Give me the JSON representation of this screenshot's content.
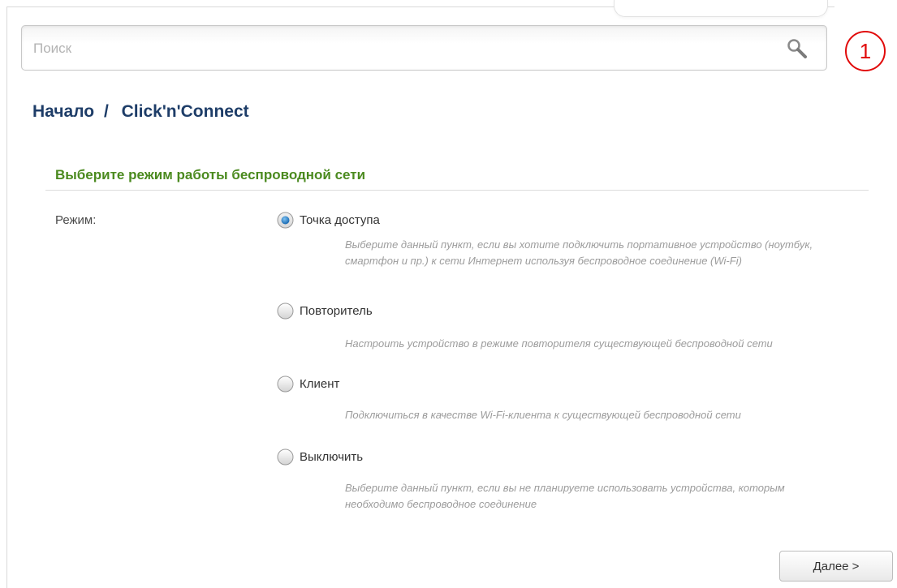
{
  "search": {
    "placeholder": "Поиск"
  },
  "notifications": {
    "count": "1",
    "color": "#e10a0a"
  },
  "breadcrumb": {
    "home": "Начало",
    "separator": "/",
    "current": "Click'n'Connect"
  },
  "section": {
    "title": "Выберите режим работы беспроводной сети"
  },
  "mode": {
    "label": "Режим:",
    "selected": "access_point",
    "options": [
      {
        "id": "access_point",
        "label": "Точка доступа",
        "description": "Выберите данный пункт, если вы хотите подключить портативное устройство (ноутбук, смартфон и пр.) к сети Интернет используя беспроводное соединение (Wi-Fi)"
      },
      {
        "id": "repeater",
        "label": "Повторитель",
        "description": "Настроить устройство в режиме повторителя существующей беспроводной сети"
      },
      {
        "id": "client",
        "label": "Клиент",
        "description": "Подключиться в качестве Wi-Fi-клиента к существующей беспроводной сети"
      },
      {
        "id": "disable",
        "label": "Выключить",
        "description": "Выберите данный пункт, если вы не планируете использовать устройства, которым необходимо беспроводное соединение"
      }
    ]
  },
  "actions": {
    "next_label": "Далее >"
  },
  "colors": {
    "breadcrumb": "#1e3d68",
    "section_title": "#4b8a1f",
    "radio_selected": "#1f6fb6",
    "description": "#9c9c9c"
  }
}
